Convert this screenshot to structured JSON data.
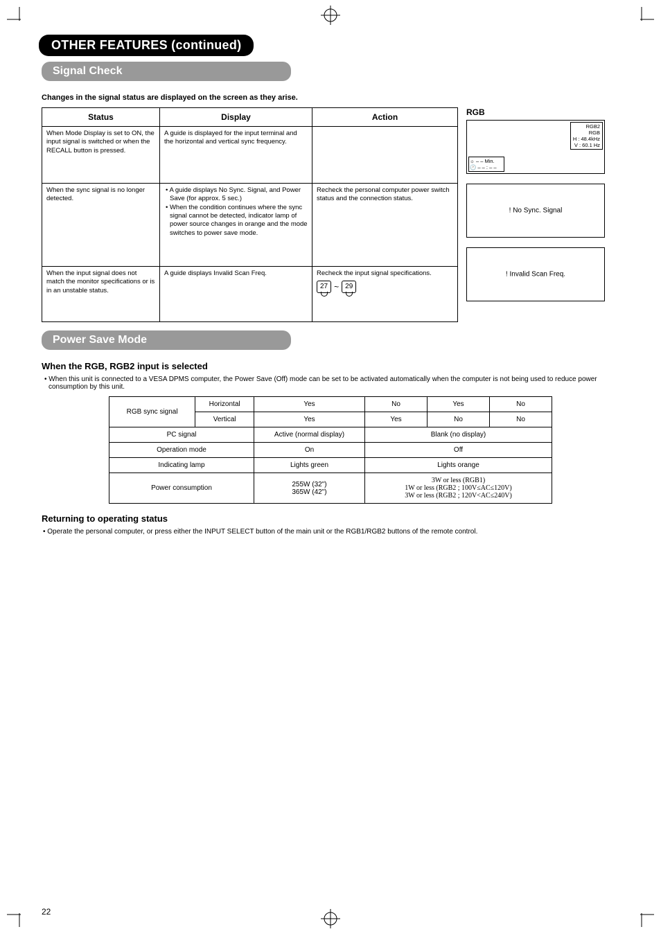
{
  "crop": {},
  "title_main": "OTHER FEATURES (continued)",
  "section_signal": "Signal Check",
  "signal_subtext": "Changes in the signal status are displayed on the screen as they arise.",
  "status_table": {
    "headers": {
      "status": "Status",
      "display": "Display",
      "action": "Action"
    },
    "rows": [
      {
        "status": "When Mode Display is set to ON, the input signal is switched or when the RECALL button is pressed.",
        "display": "A guide is displayed for the input terminal and the horizontal and vertical sync frequency.",
        "action": ""
      },
      {
        "status": "When the sync signal is no longer detected.",
        "display_b1": "• A guide displays No Sync. Signal, and Power Save (for approx. 5 sec.)",
        "display_b2": "• When the condition continues where the sync signal cannot be detected, indicator lamp of power source changes in orange and the mode switches to power save mode.",
        "action": "Recheck the personal computer power switch status and the connection status."
      },
      {
        "status": "When the input signal does not match the monitor specifications or is in an unstable status.",
        "display": "A guide displays Invalid Scan Freq.",
        "action": "Recheck the input signal specifications.",
        "pg1": "27",
        "pg_tilde": "~",
        "pg2": "29"
      }
    ]
  },
  "rgb_label": "RGB",
  "screen1": {
    "l1": "RGB2",
    "l2": "RGB",
    "l3": "H :  48.4kHz",
    "l4": "V :  60.1 Hz",
    "bl1": "☼   – – Min.",
    "bl2": "🕐  – – : – –"
  },
  "screen2": {
    "center": "! No Sync. Signal"
  },
  "screen3": {
    "center": "! Invalid Scan Freq."
  },
  "section_power": "Power Save Mode",
  "ps_heading": "When the RGB, RGB2 input is selected",
  "ps_note": "• When this unit is connected to a VESA DPMS computer, the Power Save (Off) mode can be set to be activated automatically when the computer is not being used to reduce power consumption by this unit.",
  "ps_table": {
    "h_rgb": "RGB sync signal",
    "h_horiz": "Horizontal",
    "h_vert": "Vertical",
    "yes": "Yes",
    "no": "No",
    "pc_signal": "PC signal",
    "active": "Active (normal display)",
    "blank": "Blank (no display)",
    "op_mode": "Operation mode",
    "on": "On",
    "off": "Off",
    "ind_lamp": "Indicating lamp",
    "green": "Lights green",
    "orange": "Lights orange",
    "power_cons": "Power consumption",
    "watts": "255W (32\")\n365W (42\")",
    "low1": "3W or less (RGB1)",
    "low2": "1W or less (RGB2 ; 100V≤AC≤120V)",
    "low3": "3W or less (RGB2 ; 120V<AC≤240V)"
  },
  "ret_heading": "Returning to operating status",
  "ret_note": "• Operate the personal computer, or press either the INPUT SELECT button of the main unit or the RGB1/RGB2 buttons of the remote control.",
  "page_num": "22"
}
